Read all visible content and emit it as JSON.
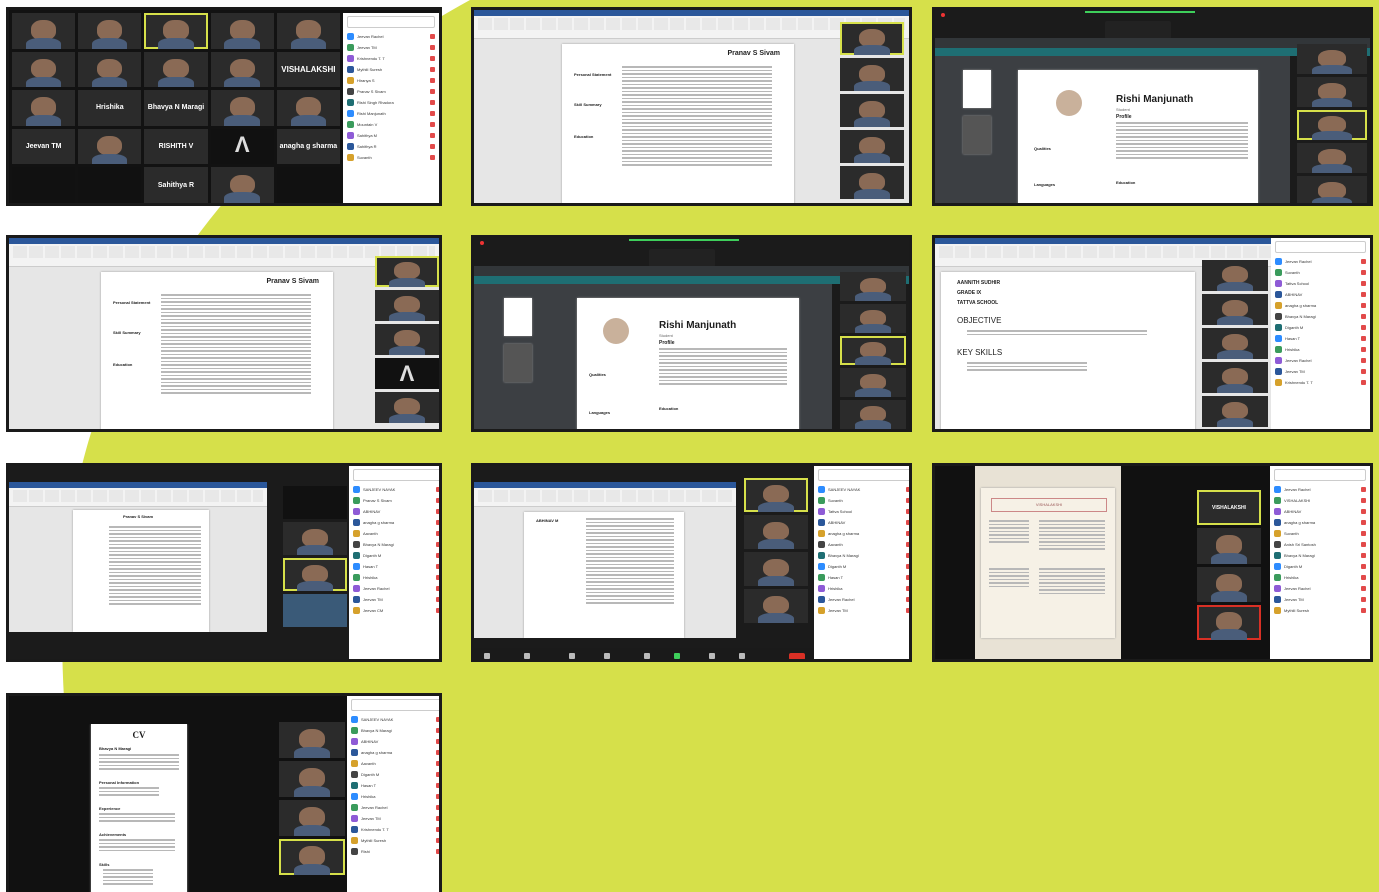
{
  "colors": {
    "accent_yellow": "#d6e04a",
    "zoom_dark": "#1f1f1f",
    "word_blue": "#2b579a",
    "mic_red": "#e24a4a"
  },
  "shot1": {
    "tiles": [
      "Hrishika",
      "Bhavya N Maragi",
      "VISHALAKSHI",
      "Jeevan TM",
      "RISHITH V",
      "anagha g sharma",
      "Sahithya R"
    ],
    "participants": [
      "Jeevan Rachel",
      "Jeevan TM",
      "Krishnendu T. T",
      "Mythili Suresh",
      "Hiranya S",
      "Pranav S Sivam",
      "Rishi Singh Rhadora",
      "Rishi Manjunath",
      "Mountain V",
      "Sahithya M",
      "Sahithya R",
      "Suvanth"
    ]
  },
  "shot2": {
    "doc_title": "Pranav S Sivam",
    "rows": [
      "Personal Statement",
      "Skill Summary",
      "Education"
    ]
  },
  "shot3": {
    "cv_name": "Rishi Manjunath",
    "cv_sub": "Student",
    "section": "Profile",
    "skills": [
      "Qualities",
      "Education",
      "Languages"
    ]
  },
  "shot4": {
    "doc_title": "Pranav S Sivam",
    "rows": [
      "Personal Statement",
      "Skill Summary",
      "Education"
    ]
  },
  "shot5": {
    "cv_name": "Rishi Manjunath",
    "cv_sub": "Student",
    "section": "Profile",
    "skills": [
      "Qualities",
      "Education",
      "Languages"
    ]
  },
  "shot6": {
    "doc_lines": [
      "AANNITH SUDHIR",
      "GRADE IX",
      "TATTVA SCHOOL"
    ],
    "objective": "OBJECTIVE",
    "key_skills": "KEY SKILLS",
    "participants": [
      "Jeevan Rachel",
      "Suvanth",
      "Tattva School",
      "ABHINAV",
      "anagha g sharma",
      "Bhavya N Maragi",
      "Diganth M",
      "Hasan T",
      "Hrishika",
      "Jeevan Rachel",
      "Jeevan TM",
      "Krishnendu T. T"
    ]
  },
  "shot7": {
    "doc_title": "Pranav S Sivam",
    "participants": [
      "SANJEEV NAYAK",
      "Pranav S Sivam",
      "ABHINAV",
      "anagha g sharma",
      "Aavanth",
      "Bhavya N Maragi",
      "Diganth M",
      "Hasan T",
      "Hrishika",
      "Jeevan Rachel",
      "Jeevan TM",
      "Jeevan CM"
    ]
  },
  "shot8": {
    "doc_title": "ABHINAV M",
    "participants": [
      "SANJEEV NAYAK",
      "Suvanth",
      "Tattva School",
      "ABHINAV",
      "anagha g sharma",
      "Aavanth",
      "Bhavya N Maragi",
      "Diganth M",
      "Hasan T",
      "Hrishika",
      "Jeevan Rachel",
      "Jeevan TM"
    ]
  },
  "shot9": {
    "cv_banner": "VISHALAKSHI",
    "tile": "VISHALAKSHI",
    "participants": [
      "Jeevan Rachel",
      "VISHALAKSHI",
      "ABHINAV",
      "anagha g sharma",
      "Suvanth",
      "Anish Sri Santosh",
      "Bhavya N Maragi",
      "Diganth M",
      "Hrishika",
      "Jeevan Rachel",
      "Jeevan TM",
      "Mythili Suresh"
    ]
  },
  "shot10": {
    "cv_title": "CV",
    "cv_name": "Bhavya N Maragi",
    "sections": [
      "Personal Information",
      "Experience",
      "Achievements",
      "Skills"
    ],
    "participants": [
      "SANJEEV NAYAK",
      "Bhavya N Maragi",
      "ABHINAV",
      "anagha g sharma",
      "Aavanth",
      "Diganth M",
      "Hasan T",
      "Hrishika",
      "Jeevan Rachel",
      "Jeevan TM",
      "Krishnendu T. T",
      "Mythili Suresh",
      "Rishi"
    ]
  }
}
